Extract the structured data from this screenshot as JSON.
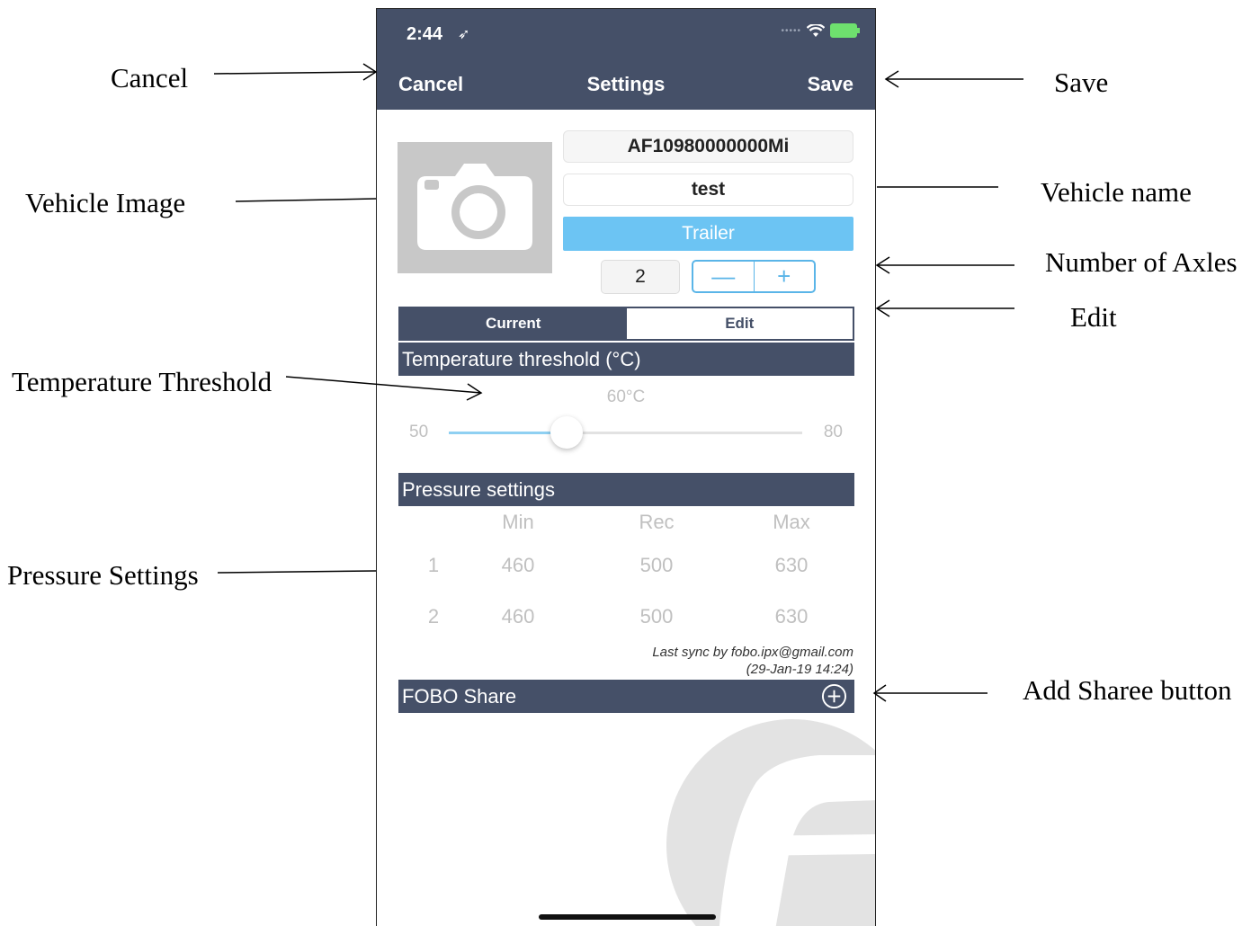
{
  "annotations": {
    "cancel": "Cancel",
    "save": "Save",
    "vehicle_image": "Vehicle Image",
    "vehicle_name": "Vehicle name",
    "number_of_axles": "Number of Axles",
    "edit": "Edit",
    "temperature_threshold": "Temperature Threshold",
    "pressure_settings": "Pressure Settings",
    "add_sharee_button": "Add Sharee button"
  },
  "status_bar": {
    "time": "2:44",
    "location_icon": "location-arrow-icon",
    "wifi_icon": "wifi-icon",
    "battery_icon": "battery-charging-icon"
  },
  "nav": {
    "cancel": "Cancel",
    "title": "Settings",
    "save": "Save"
  },
  "vehicle": {
    "image_icon": "camera-icon",
    "id": "AF10980000000Mi",
    "name": "test",
    "type": "Trailer",
    "axles": "2",
    "stepper_minus": "—",
    "stepper_plus": "+"
  },
  "segment": {
    "current": "Current",
    "edit": "Edit",
    "selected": "Current"
  },
  "temperature": {
    "title": "Temperature threshold (°C)",
    "value_label": "60°C",
    "min": "50",
    "max": "80",
    "value": 60
  },
  "pressure": {
    "title": "Pressure settings",
    "headers": [
      "",
      "Min",
      "Rec",
      "Max"
    ],
    "rows": [
      [
        "1",
        "460",
        "500",
        "630"
      ],
      [
        "2",
        "460",
        "500",
        "630"
      ]
    ]
  },
  "sync": {
    "line1": "Last sync by fobo.ipx@gmail.com",
    "line2": "(29-Jan-19 14:24)"
  },
  "share": {
    "title": "FOBO Share",
    "add_icon": "plus-circle-icon"
  },
  "colors": {
    "header": "#455068",
    "accent": "#6cc4f3",
    "stepper": "#5ab5e8",
    "muted": "#c0c0c0"
  }
}
